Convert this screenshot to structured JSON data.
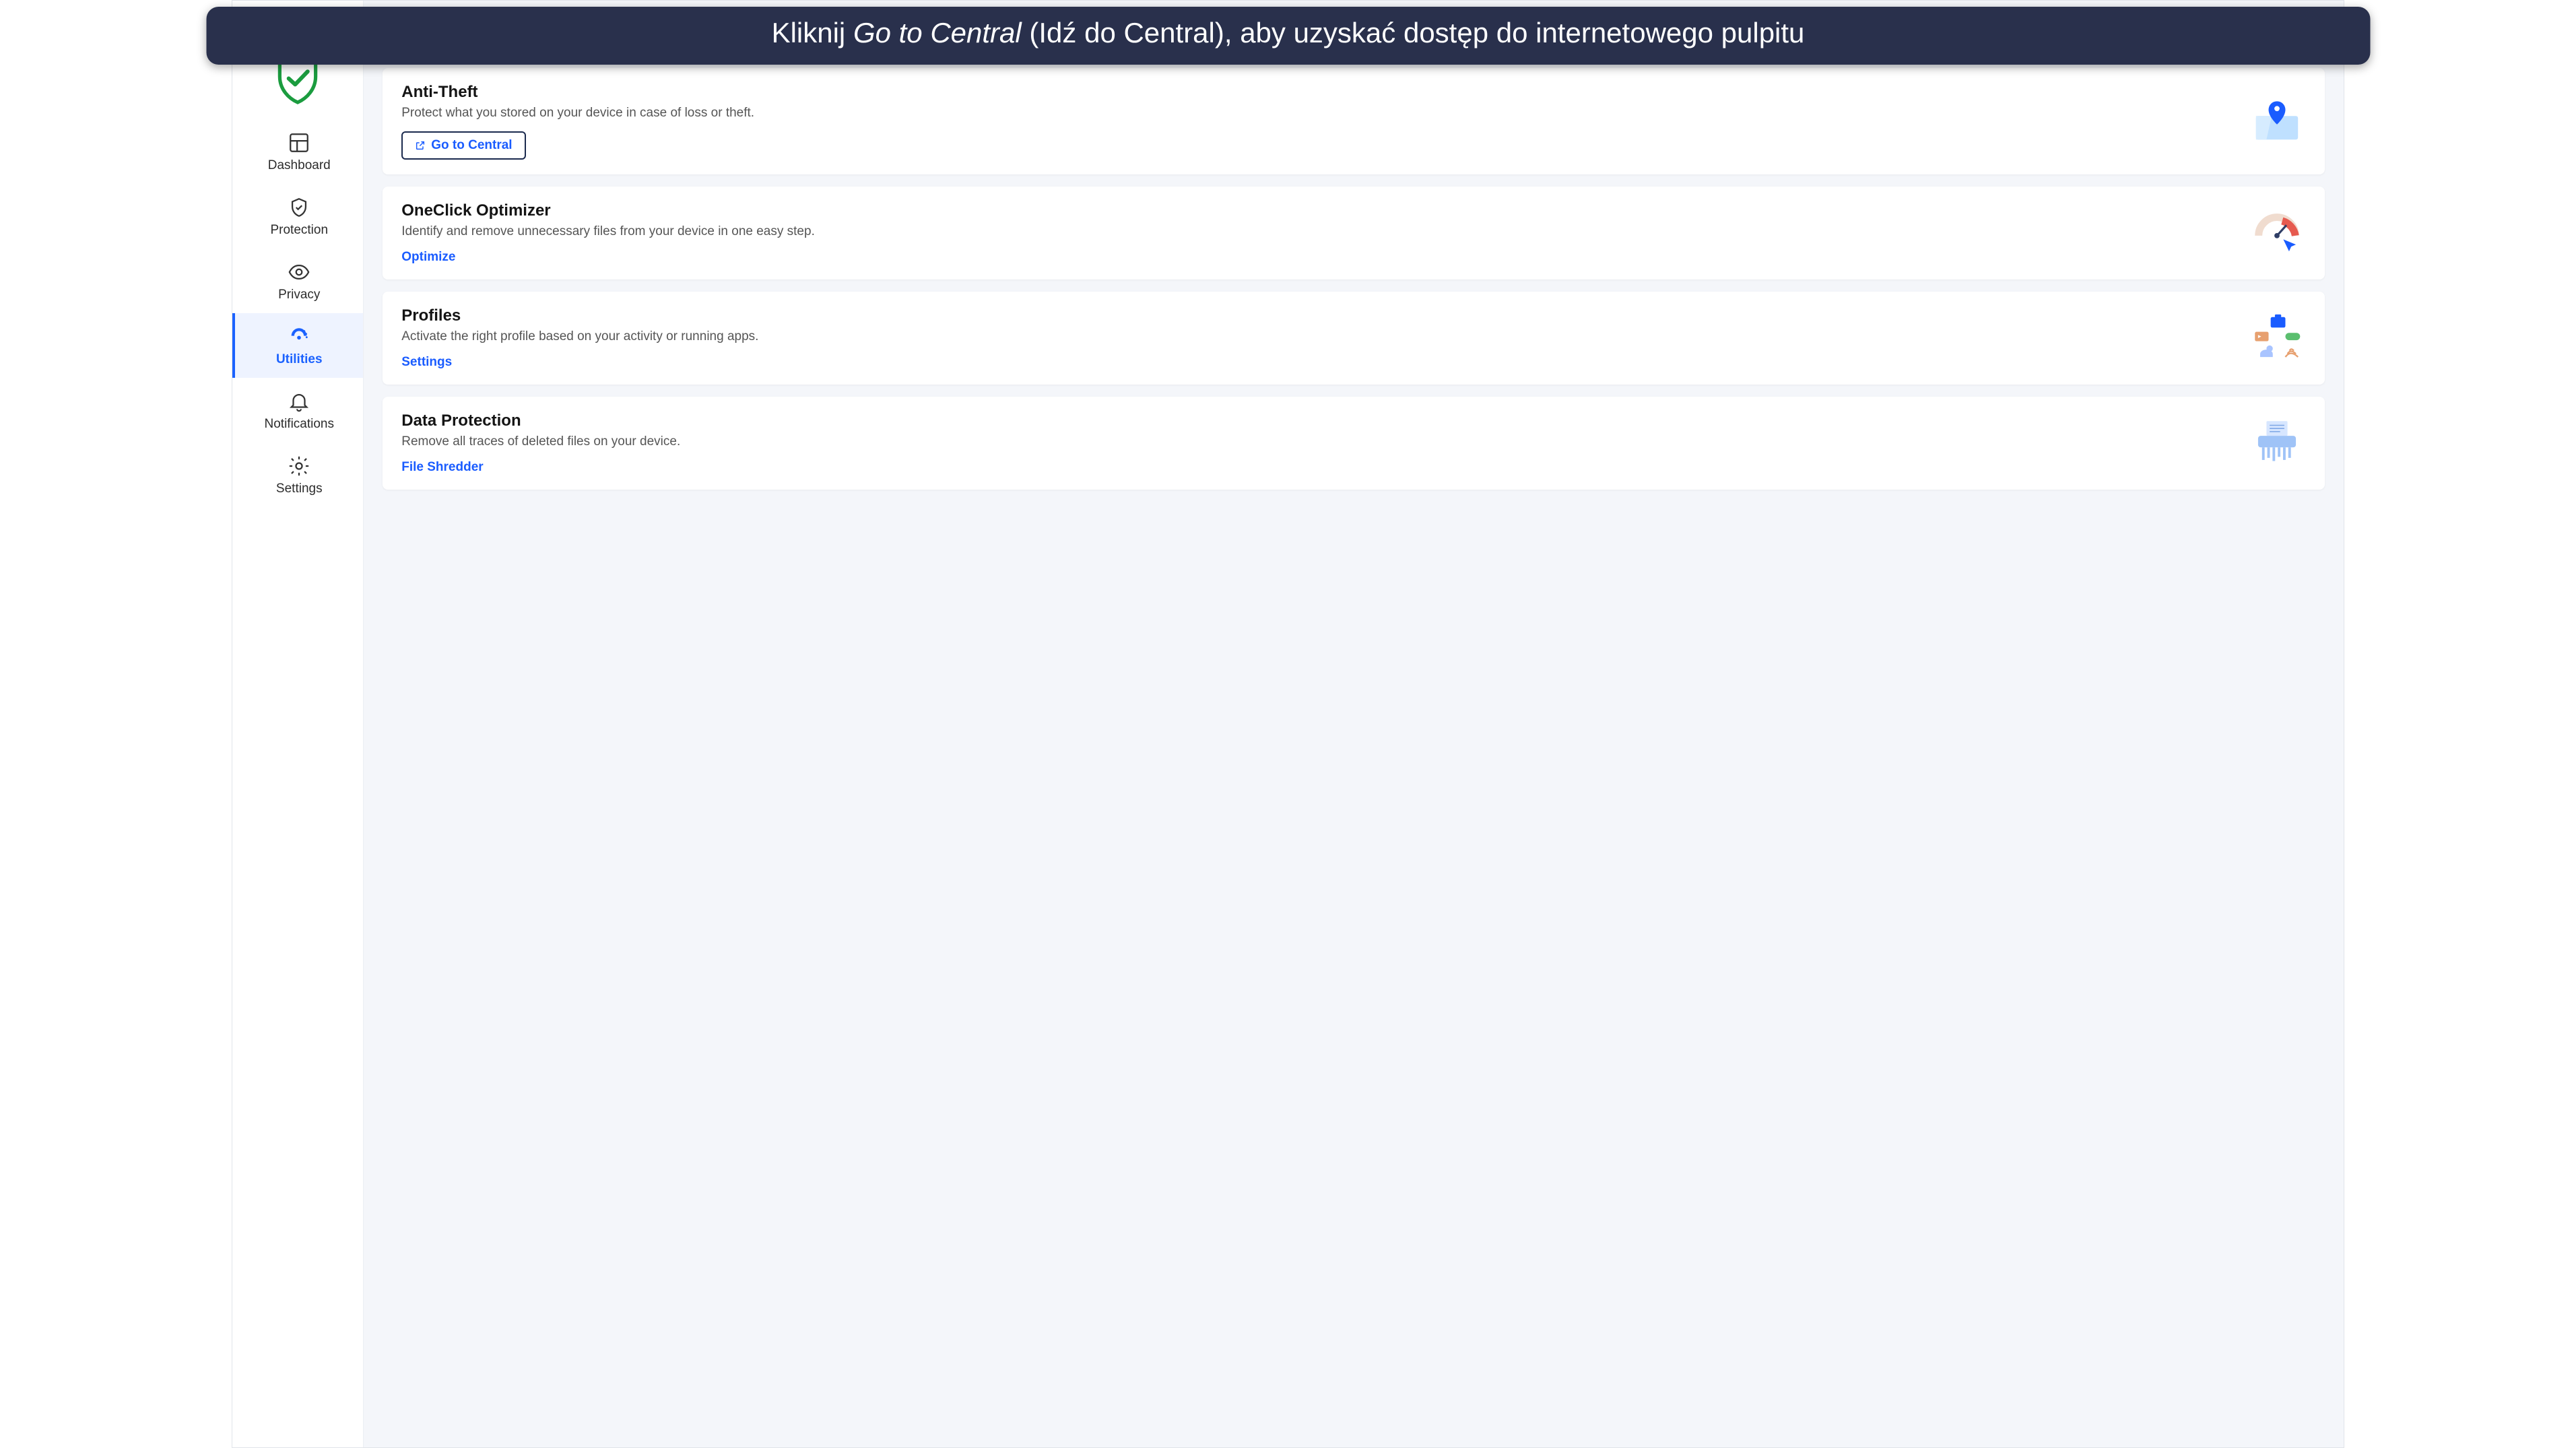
{
  "caption": {
    "prefix": "Kliknij ",
    "em": "Go to Central",
    "suffix": " (Idź do Central), aby uzyskać dostęp do internetowego pulpitu"
  },
  "sidebar": {
    "items": [
      {
        "id": "dashboard",
        "label": "Dashboard"
      },
      {
        "id": "protection",
        "label": "Protection"
      },
      {
        "id": "privacy",
        "label": "Privacy"
      },
      {
        "id": "utilities",
        "label": "Utilities"
      },
      {
        "id": "notifications",
        "label": "Notifications"
      },
      {
        "id": "settings",
        "label": "Settings"
      }
    ],
    "active": "utilities"
  },
  "cards": {
    "antitheft": {
      "title": "Anti-Theft",
      "desc": "Protect what you stored on your device in case of loss or theft.",
      "action": "Go to Central"
    },
    "optimizer": {
      "title": "OneClick Optimizer",
      "desc": "Identify and remove unnecessary files from your device in one easy step.",
      "action": "Optimize"
    },
    "profiles": {
      "title": "Profiles",
      "desc": "Activate the right profile based on your activity or running apps.",
      "action": "Settings"
    },
    "dataprotection": {
      "title": "Data Protection",
      "desc": "Remove all traces of deleted files on your device.",
      "action": "File Shredder"
    }
  }
}
